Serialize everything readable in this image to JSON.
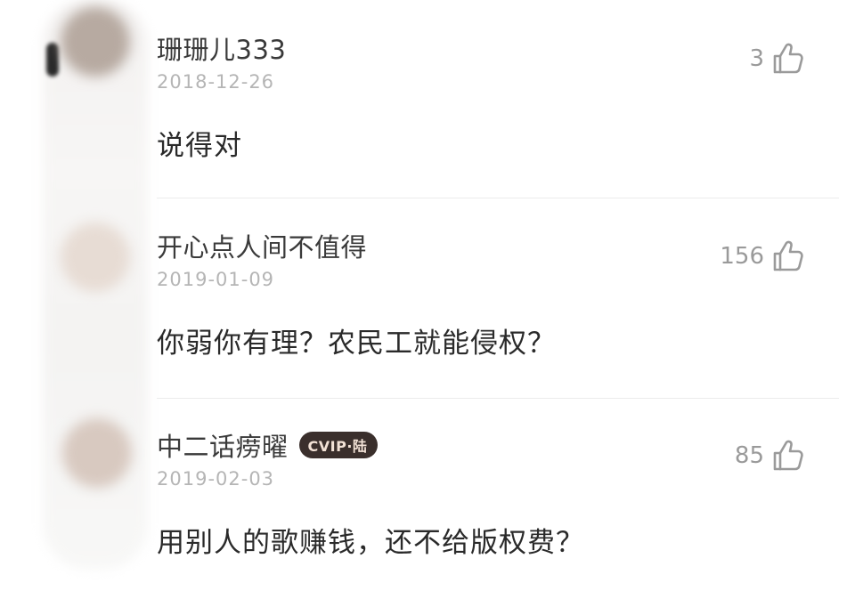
{
  "comments": [
    {
      "username": "珊珊儿333",
      "date": "2018-12-26",
      "text": "说得对",
      "likes": "3",
      "badge": ""
    },
    {
      "username": "开心点人间不值得",
      "date": "2019-01-09",
      "text": "你弱你有理？农民工就能侵权？",
      "likes": "156",
      "badge": ""
    },
    {
      "username": "中二话痨曜",
      "date": "2019-02-03",
      "text": "用别人的歌赚钱，还不给版权费？",
      "likes": "85",
      "badge": "CVIP·陆"
    }
  ],
  "icons": {
    "like": "thumbs-up-icon",
    "avatar": "avatar"
  },
  "colors": {
    "username": "#3a3a3a",
    "date": "#b5b5b5",
    "text": "#2a2a2a",
    "likes": "#9a9a9a",
    "badge_bg": "#3a2f2c",
    "badge_fg": "#f2e2d6"
  }
}
